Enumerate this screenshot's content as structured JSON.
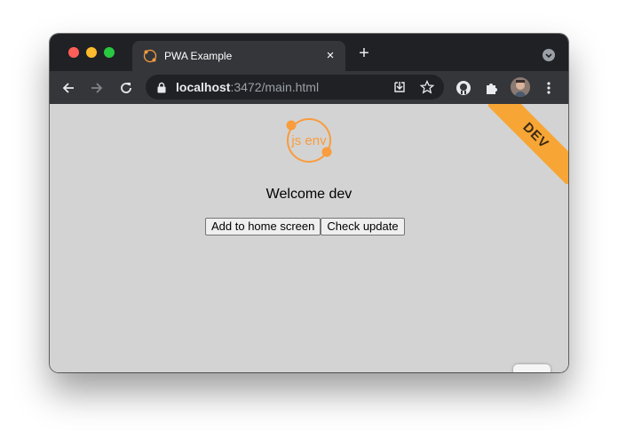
{
  "tab": {
    "title": "PWA Example",
    "close_label": "×"
  },
  "titlebar": {
    "new_tab_label": "+"
  },
  "toolbar": {
    "url_host": "localhost",
    "url_path": ":3472/main.html"
  },
  "page": {
    "logo_text": "js env",
    "welcome_text": "Welcome dev",
    "add_to_home_label": "Add to home screen",
    "check_update_label": "Check update",
    "ribbon_text": "DEV"
  },
  "colors": {
    "page_background": "#d3d3d3",
    "ribbon": "#f7a535",
    "logo": "#f89c3d",
    "chrome_dark": "#202124",
    "chrome_toolbar": "#35363a"
  },
  "icons": {
    "traffic_lights": [
      "close-window-icon",
      "minimize-window-icon",
      "maximize-window-icon"
    ],
    "toolbar": [
      "back-arrow-icon",
      "forward-arrow-icon",
      "reload-icon",
      "lock-icon",
      "install-app-icon",
      "star-bookmark-icon",
      "github-extension-icon",
      "puzzle-extensions-icon",
      "avatar",
      "kebab-menu-icon"
    ]
  }
}
